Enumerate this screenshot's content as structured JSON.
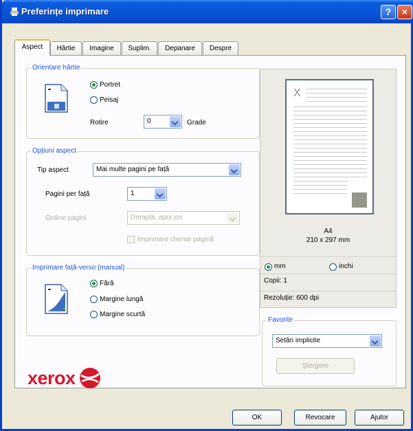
{
  "window": {
    "title": "Preferințe imprimare",
    "help_glyph": "?",
    "close_glyph": "×"
  },
  "tabs": [
    "Aspect",
    "Hârtie",
    "Imagine",
    "Suplim.",
    "Depanare",
    "Despre"
  ],
  "orientation": {
    "title": "Orientare hârtie",
    "portrait": "Portret",
    "landscape": "Peisaj",
    "rotate_label": "Rotire",
    "rotate_value": "0",
    "degrees_label": "Grade"
  },
  "layout": {
    "title": "Opțiuni aspect",
    "type_label": "Tip aspect",
    "type_value": "Mai multe pagini pe față",
    "pages_label": "Pagini per față",
    "pages_value": "1",
    "order_label": "Ordine pagini",
    "order_value": "Dreapta, apoi jos",
    "border_label": "Imprimare chenar pagină"
  },
  "duplex": {
    "title": "Imprimare față-verso (manual)",
    "none": "Fără",
    "long_edge": "Margine lungă",
    "short_edge": "Margine scurtă"
  },
  "preview": {
    "paper_size": "A4",
    "paper_dims": "210 x 297 mm",
    "mark": "X",
    "unit_mm": "mm",
    "unit_inch": "inchi",
    "copies": "Copii: 1",
    "resolution": "Rezoluție: 600 dpi"
  },
  "favorites": {
    "title": "Favorite",
    "selected": "Setări implicite",
    "delete_label": "Ștergere"
  },
  "brand": {
    "name": "xerox"
  },
  "footer": {
    "ok": "OK",
    "cancel": "Revocare",
    "help": "Ajutor"
  },
  "colors": {
    "title_bar": "#0a53d6",
    "group_title": "#2155d2",
    "brand_red": "#d6182c"
  }
}
